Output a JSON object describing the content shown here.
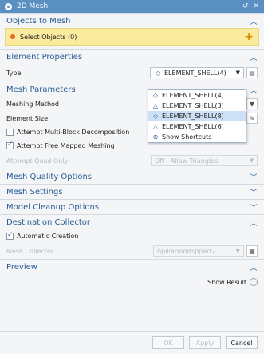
{
  "window": {
    "title": "2D Mesh",
    "restore": "↺",
    "close": "✕"
  },
  "objects_to_mesh": {
    "header": "Objects to Mesh",
    "select_label": "Select Objects (0)"
  },
  "element_properties": {
    "header": "Element Properties",
    "type_label": "Type",
    "type_value": "ELEMENT_SHELL(4)"
  },
  "type_dropdown": {
    "items": [
      {
        "icon": "◇",
        "label": "ELEMENT_SHELL(4)",
        "selected": false
      },
      {
        "icon": "△",
        "label": "ELEMENT_SHELL(3)",
        "selected": false
      },
      {
        "icon": "◇",
        "label": "ELEMENT_SHELL(8)",
        "selected": true
      },
      {
        "icon": "△",
        "label": "ELEMENT_SHELL(6)",
        "selected": false
      },
      {
        "icon": "⊕",
        "label": "Show Shortcuts",
        "selected": false
      }
    ]
  },
  "mesh_parameters": {
    "header": "Mesh Parameters",
    "meshing_method_label": "Meshing Method",
    "element_size_label": "Element Size",
    "multi_block_label": "Attempt Multi-Block Decomposition",
    "multi_block_checked": false,
    "free_mapped_label": "Attempt Free Mapped Meshing",
    "free_mapped_checked": true,
    "quad_only_label": "Attempt Quad Only",
    "quad_only_value": "Off - Allow Triangles"
  },
  "mesh_quality": {
    "header": "Mesh Quality Options"
  },
  "mesh_settings": {
    "header": "Mesh Settings"
  },
  "model_cleanup": {
    "header": "Model Cleanup Options"
  },
  "destination": {
    "header": "Destination Collector",
    "auto_label": "Automatic Creation",
    "auto_checked": true,
    "collector_label": "Mesh Collector",
    "collector_value": "bpillarmoltsppart2"
  },
  "preview": {
    "header": "Preview",
    "show_result": "Show Result"
  },
  "footer": {
    "ok": "OK",
    "apply": "Apply",
    "cancel": "Cancel"
  }
}
